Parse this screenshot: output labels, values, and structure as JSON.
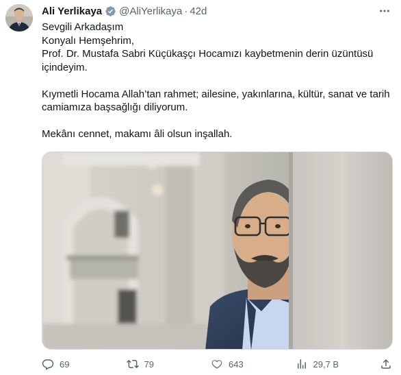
{
  "author": {
    "name": "Ali Yerlikaya",
    "handle": "@AliYerlikaya",
    "separator": "·",
    "time": "42d"
  },
  "tweet": {
    "lines": [
      "Sevgili Arkadaşım",
      "Konyalı Hemşehrim,",
      "Prof. Dr. Mustafa Sabri Küçükaşçı Hocamızı kaybetmenin derin üzüntüsü içindeyim."
    ],
    "paragraph2": "Kıymetli Hocama Allah’tan rahmet; ailesine, yakınlarına, kültür, sanat ve tarih camiamıza başsağlığı diliyorum.",
    "paragraph3": "Mekânı cennet, makamı âli olsun inşallah."
  },
  "actions": {
    "replies": "69",
    "retweets": "79",
    "likes": "643",
    "views": "29,7 B"
  },
  "colors": {
    "text": "#0f1419",
    "secondary": "#536471",
    "verified": "#829aab",
    "border": "#cfd9de"
  },
  "icons": {
    "verified": "verified-badge-icon",
    "more": "more-icon",
    "reply": "reply-icon",
    "retweet": "retweet-icon",
    "like": "like-icon",
    "views": "views-icon",
    "share": "share-icon"
  }
}
